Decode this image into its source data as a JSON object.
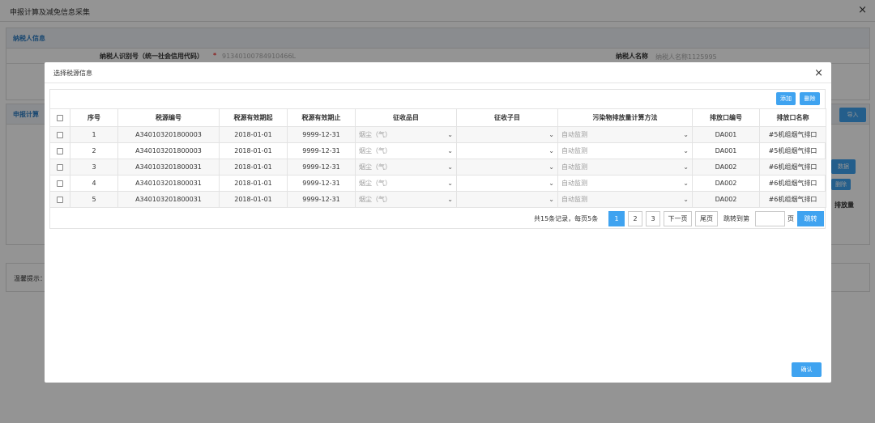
{
  "window": {
    "title": "申报计算及减免信息采集",
    "close": "×"
  },
  "background": {
    "taxpayer_panel_title": "纳税人信息",
    "taxpayer_id_label": "纳税人识别号（统一社会信用代码）",
    "taxpayer_id_required": "*",
    "taxpayer_id_value": "91340100784910466L",
    "taxpayer_name_label": "纳税人名称",
    "taxpayer_name_value": "纳税人名称1125995",
    "calc_panel_title": "申报计算",
    "import_button": "导入",
    "data_button": "数据",
    "delete_button": "删除",
    "emission_col": "排放量",
    "hint_label": "温馨提示："
  },
  "modal": {
    "title": "选择税源信息",
    "close": "×",
    "add_button": "添加",
    "delete_button": "删除",
    "columns": [
      "序号",
      "税源编号",
      "税源有效期起",
      "税源有效期止",
      "征收品目",
      "征收子目",
      "污染物排放量计算方法",
      "排放口编号",
      "排放口名称"
    ],
    "rows": [
      {
        "no": "1",
        "source_id": "A340103201800003",
        "start": "2018-01-01",
        "end": "9999-12-31",
        "item": "烟尘（气）",
        "subitem": "",
        "method": "自动监测",
        "outlet_no": "DA001",
        "outlet_name": "#5机组烟气排口"
      },
      {
        "no": "2",
        "source_id": "A340103201800003",
        "start": "2018-01-01",
        "end": "9999-12-31",
        "item": "烟尘（气）",
        "subitem": "",
        "method": "自动监测",
        "outlet_no": "DA001",
        "outlet_name": "#5机组烟气排口"
      },
      {
        "no": "3",
        "source_id": "A340103201800031",
        "start": "2018-01-01",
        "end": "9999-12-31",
        "item": "烟尘（气）",
        "subitem": "",
        "method": "自动监测",
        "outlet_no": "DA002",
        "outlet_name": "#6机组烟气排口"
      },
      {
        "no": "4",
        "source_id": "A340103201800031",
        "start": "2018-01-01",
        "end": "9999-12-31",
        "item": "烟尘（气）",
        "subitem": "",
        "method": "自动监测",
        "outlet_no": "DA002",
        "outlet_name": "#6机组烟气排口"
      },
      {
        "no": "5",
        "source_id": "A340103201800031",
        "start": "2018-01-01",
        "end": "9999-12-31",
        "item": "烟尘（气）",
        "subitem": "",
        "method": "自动监测",
        "outlet_no": "DA002",
        "outlet_name": "#6机组烟气排口"
      }
    ],
    "pagination": {
      "summary": "共15条记录，每页5条",
      "pages": [
        "1",
        "2",
        "3"
      ],
      "current_page": "1",
      "next": "下一页",
      "last": "尾页",
      "jump_label": "跳转到第",
      "page_unit": "页",
      "jump_button": "跳转"
    },
    "confirm_button": "确认"
  },
  "colors": {
    "accent": "#3fa3f0",
    "header_text": "#2b7bc2"
  }
}
